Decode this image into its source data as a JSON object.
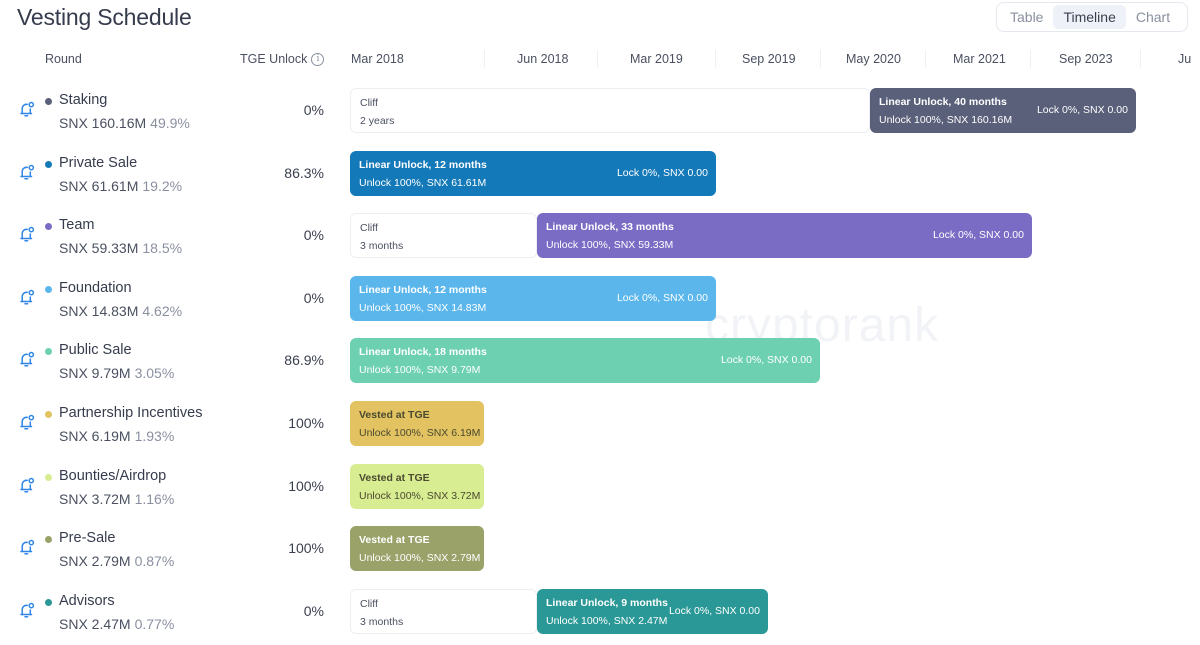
{
  "title": "Vesting Schedule",
  "view_switch": {
    "options": [
      "Table",
      "Timeline",
      "Chart"
    ],
    "active": "Timeline"
  },
  "columns": {
    "round": "Round",
    "tge_unlock": "TGE Unlock",
    "info_icon": "info-icon"
  },
  "timeline_ticks": [
    "Mar 2018",
    "Jun 2018",
    "Mar 2019",
    "Sep 2019",
    "May 2020",
    "Mar 2021",
    "Sep 2023",
    "Ju"
  ],
  "watermark": "cryptorank",
  "token": "SNX",
  "rounds": [
    {
      "name": "Staking",
      "amount": "SNX 160.16M",
      "share": "49.9%",
      "tge": "0%",
      "color": "#5a5f7a",
      "cliff": {
        "label": "Cliff",
        "duration": "2 years"
      },
      "bar": {
        "title": "Linear Unlock, 40 months",
        "unlock": "Unlock 100%, SNX 160.16M",
        "lock": "Lock 0%, SNX 0.00",
        "color": "#5a5f7a"
      }
    },
    {
      "name": "Private Sale",
      "amount": "SNX 61.61M",
      "share": "19.2%",
      "tge": "86.3%",
      "color": "#1479b8",
      "cliff": null,
      "bar": {
        "title": "Linear Unlock, 12 months",
        "unlock": "Unlock 100%, SNX 61.61M",
        "lock": "Lock 0%, SNX 0.00",
        "color": "#1479b8"
      }
    },
    {
      "name": "Team",
      "amount": "SNX 59.33M",
      "share": "18.5%",
      "tge": "0%",
      "color": "#7a6cc4",
      "cliff": {
        "label": "Cliff",
        "duration": "3 months"
      },
      "bar": {
        "title": "Linear Unlock, 33 months",
        "unlock": "Unlock 100%, SNX 59.33M",
        "lock": "Lock 0%, SNX 0.00",
        "color": "#7a6cc4"
      }
    },
    {
      "name": "Foundation",
      "amount": "SNX 14.83M",
      "share": "4.62%",
      "tge": "0%",
      "color": "#5bb6ec",
      "cliff": null,
      "bar": {
        "title": "Linear Unlock, 12 months",
        "unlock": "Unlock 100%, SNX 14.83M",
        "lock": "Lock 0%, SNX 0.00",
        "color": "#5bb6ec"
      }
    },
    {
      "name": "Public Sale",
      "amount": "SNX 9.79M",
      "share": "3.05%",
      "tge": "86.9%",
      "color": "#6dd0b1",
      "cliff": null,
      "bar": {
        "title": "Linear Unlock, 18 months",
        "unlock": "Unlock 100%, SNX 9.79M",
        "lock": "Lock 0%, SNX 0.00",
        "color": "#6dd0b1"
      }
    },
    {
      "name": "Partnership Incentives",
      "amount": "SNX 6.19M",
      "share": "1.93%",
      "tge": "100%",
      "color": "#e2c261",
      "cliff": null,
      "bar": {
        "title": "Vested at TGE",
        "unlock": "Unlock 100%, SNX 6.19M",
        "lock": null,
        "color": "#e2c261"
      }
    },
    {
      "name": "Bounties/Airdrop",
      "amount": "SNX 3.72M",
      "share": "1.16%",
      "tge": "100%",
      "color": "#d8ec92",
      "cliff": null,
      "bar": {
        "title": "Vested at TGE",
        "unlock": "Unlock 100%, SNX 3.72M",
        "lock": null,
        "color": "#d8ec92"
      }
    },
    {
      "name": "Pre-Sale",
      "amount": "SNX 2.79M",
      "share": "0.87%",
      "tge": "100%",
      "color": "#9aa26a",
      "cliff": null,
      "bar": {
        "title": "Vested at TGE",
        "unlock": "Unlock 100%, SNX 2.79M",
        "lock": null,
        "color": "#9aa26a"
      }
    },
    {
      "name": "Advisors",
      "amount": "SNX 2.47M",
      "share": "0.77%",
      "tge": "0%",
      "color": "#2a9896",
      "cliff": {
        "label": "Cliff",
        "duration": "3 months"
      },
      "bar": {
        "title": "Linear Unlock, 9 months",
        "unlock": "Unlock 100%, SNX 2.47M",
        "lock": "Lock 0%, SNX 0.00",
        "color": "#2a9896"
      }
    }
  ]
}
